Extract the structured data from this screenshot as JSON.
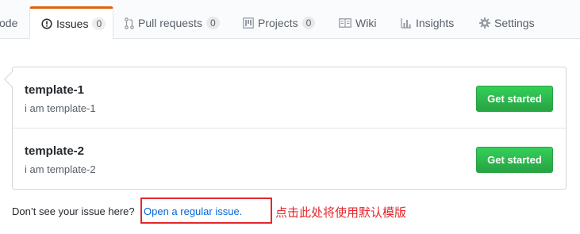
{
  "tabs": {
    "code": {
      "label": "ode"
    },
    "issues": {
      "label": "Issues",
      "count": "0",
      "icon": "issue-opened-icon"
    },
    "pulls": {
      "label": "Pull requests",
      "count": "0",
      "icon": "git-pull-request-icon"
    },
    "projects": {
      "label": "Projects",
      "count": "0",
      "icon": "project-icon"
    },
    "wiki": {
      "label": "Wiki",
      "icon": "book-icon"
    },
    "insights": {
      "label": "Insights",
      "icon": "graph-icon"
    },
    "settings": {
      "label": "Settings",
      "icon": "gear-icon"
    },
    "selected": "issues",
    "accent_color": "#e36209"
  },
  "templates": [
    {
      "title": "template-1",
      "description": "i am template-1",
      "button_label": "Get started"
    },
    {
      "title": "template-2",
      "description": "i am template-2",
      "button_label": "Get started"
    }
  ],
  "footer": {
    "prompt": "Don’t see your issue here?",
    "link_label": "Open a regular issue."
  },
  "annotation": {
    "note": "点击此处将使用默认模版",
    "color": "#e5262b"
  }
}
